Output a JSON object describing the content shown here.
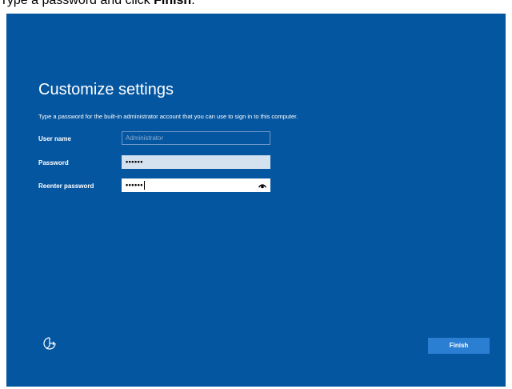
{
  "instruction": {
    "prefix": "Type a password and click ",
    "action": "Finish",
    "suffix": "."
  },
  "setup": {
    "title": "Customize settings",
    "description": "Type a password for the built-in administrator account that you can use to sign in to this computer.",
    "fields": [
      {
        "label": "User name",
        "placeholder": "Administrator",
        "value": ""
      },
      {
        "label": "Password",
        "value": "••••••"
      },
      {
        "label": "Reenter password",
        "value": "••••••"
      }
    ],
    "finish_label": "Finish"
  },
  "icons": {
    "reveal": "eye-icon",
    "accessibility": "ease-of-access-icon"
  },
  "colors": {
    "background": "#0556a0",
    "button": "#2b7fd3",
    "password_field": "#d4e1ee"
  }
}
